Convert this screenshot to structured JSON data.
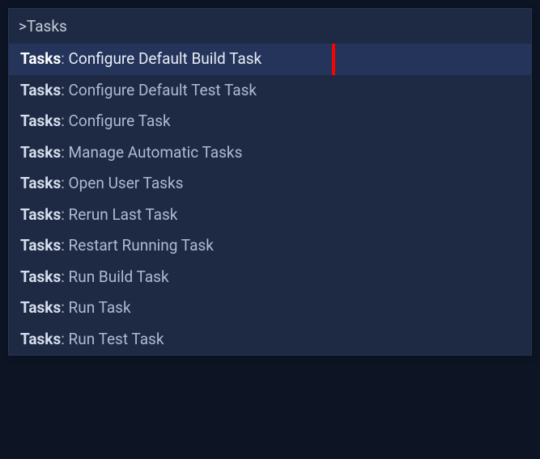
{
  "search": {
    "value": ">Tasks"
  },
  "results": [
    {
      "category": "Tasks",
      "label": "Configure Default Build Task",
      "selected": true,
      "highlighted": true
    },
    {
      "category": "Tasks",
      "label": "Configure Default Test Task",
      "selected": false,
      "highlighted": false
    },
    {
      "category": "Tasks",
      "label": "Configure Task",
      "selected": false,
      "highlighted": false
    },
    {
      "category": "Tasks",
      "label": "Manage Automatic Tasks",
      "selected": false,
      "highlighted": false
    },
    {
      "category": "Tasks",
      "label": "Open User Tasks",
      "selected": false,
      "highlighted": false
    },
    {
      "category": "Tasks",
      "label": "Rerun Last Task",
      "selected": false,
      "highlighted": false
    },
    {
      "category": "Tasks",
      "label": "Restart Running Task",
      "selected": false,
      "highlighted": false
    },
    {
      "category": "Tasks",
      "label": "Run Build Task",
      "selected": false,
      "highlighted": false
    },
    {
      "category": "Tasks",
      "label": "Run Task",
      "selected": false,
      "highlighted": false
    },
    {
      "category": "Tasks",
      "label": "Run Test Task",
      "selected": false,
      "highlighted": false
    }
  ]
}
